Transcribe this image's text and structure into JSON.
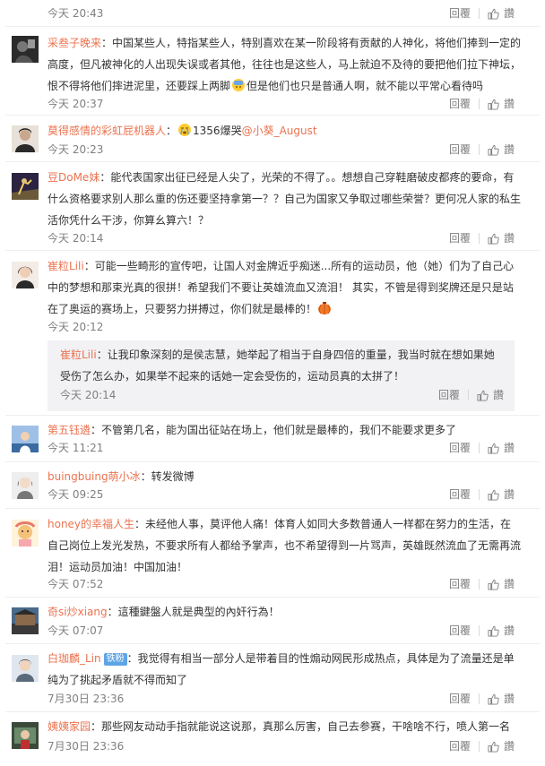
{
  "actions": {
    "reply": "回覆",
    "like": "讚"
  },
  "comments": [
    {
      "time": "今天 20:43"
    },
    {
      "user": "采叁子晚来",
      "text_a": "：中国某些人，特指某些人，特别喜欢在某一阶段将有贡献的人神化，将他们捧到一定的高度，但凡被神化的人出现失误或者其他，往往也是这些人，马上就迫不及待的要把他们拉下神坛，恨不得将他们摔进泥里，还要踩上两脚",
      "text_b": "但是他们也只是普通人啊，就不能以平常心看待吗",
      "time": "今天 20:37"
    },
    {
      "user": "莫得感情的彩虹屁机器人",
      "text_a": "：",
      "text_b": "1356爆哭",
      "mention": "@小葵_August",
      "time": "今天 20:23"
    },
    {
      "user": "豆DoMe妹",
      "text": "：能代表国家出征已经是人尖了，光荣的不得了。。想想自己穿鞋磨破皮都疼的要命，有什么资格要求别人那么重的伤还要坚持拿第一？？自己为国家又争取过哪些荣誉？更何况人家的私生活你凭什么干涉，你算幺算六！？",
      "time": "今天 20:14"
    },
    {
      "user": "崔粒Lili",
      "text": "：可能一些畸形的宣传吧，让国人对金牌近乎痴迷...所有的运动员，他（她）们为了自己心中的梦想和那束光真的很拼！希望我们不要让英雄流血又流泪！ 其实，不管是得到奖牌还是只是站在了奥运的赛场上，只要努力拼搏过，你们就是最棒的！",
      "time": "今天 20:12",
      "reply": {
        "user": "崔粒Lili",
        "text": "：让我印象深刻的是侯志慧，她举起了相当于自身四倍的重量，我当时就在想如果她受伤了怎么办，如果举不起来的话她一定会受伤的，运动员真的太拼了！",
        "time": "今天 20:14"
      }
    },
    {
      "user": "第五钰遴",
      "text": "：不管第几名，能为国出征站在场上，他们就是最棒的，我们不能要求更多了",
      "time": "今天 11:21"
    },
    {
      "user": "buingbuing萌小冰",
      "text": "：转发微博",
      "time": "今天 09:25"
    },
    {
      "user": "honey的幸福人生",
      "text": "：未经他人事，莫评他人痛！体育人如同大多数普通人一样都在努力的生活，在自己岗位上发光发热，不要求所有人都给予掌声，也不希望得到一片骂声，英雄既然流血了无需再流泪！运动员加油！中国加油！",
      "time": "今天 07:52"
    },
    {
      "user": "奇si炒xiang",
      "text": "：這種鍵盤人就是典型的內奸行為！",
      "time": "今天 07:07"
    },
    {
      "user": "白珈麟_Lin",
      "badge": "铁粉",
      "text": "：我觉得有相当一部分人是带着目的性煽动网民形成热点，具体是为了流量还是单纯为了挑起矛盾就不得而知了",
      "time": "7月30日 23:36"
    },
    {
      "user": "姨姨家园",
      "text": "：那些网友动动手指就能说这说那，真那么厉害，自己去参赛，干啥啥不行，喷人第一名",
      "time": "7月30日 23:36"
    }
  ]
}
